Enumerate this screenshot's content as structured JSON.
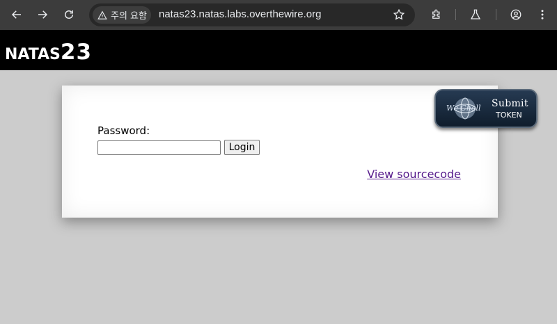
{
  "browser": {
    "security_chip": "주의 요함",
    "url": "natas23.natas.labs.overthewire.org"
  },
  "site": {
    "logo_word": "NATAS",
    "logo_number": "23"
  },
  "form": {
    "password_label": "Password:",
    "password_value": "",
    "login_label": "Login"
  },
  "links": {
    "view_source": "View sourcecode"
  },
  "badge": {
    "brand": "We Chall",
    "line1": "Submit",
    "line2": "TOKEN"
  }
}
